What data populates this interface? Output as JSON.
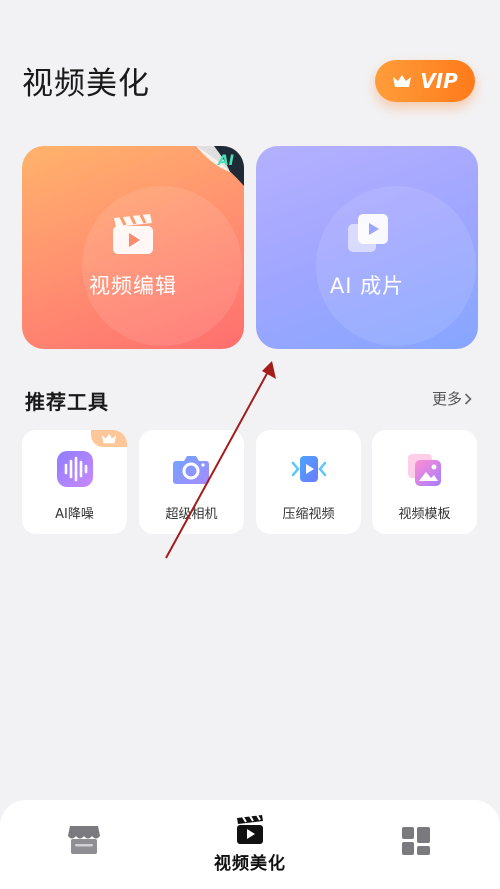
{
  "header": {
    "title": "视频美化",
    "vip_label": "VIP"
  },
  "feature_cards": [
    {
      "label": "视频编辑",
      "icon": "clapperboard-icon",
      "badge": "AI"
    },
    {
      "label": "AI 成片",
      "icon": "stacked-videos-icon"
    }
  ],
  "recommended": {
    "title": "推荐工具",
    "more_label": "更多"
  },
  "tools": [
    {
      "label": "AI降噪",
      "icon": "soundwave-icon",
      "badge": "crown-icon"
    },
    {
      "label": "超级相机",
      "icon": "camera-icon"
    },
    {
      "label": "压缩视频",
      "icon": "compress-video-icon"
    },
    {
      "label": "视频模板",
      "icon": "template-icon"
    }
  ],
  "bottom_nav": {
    "items": [
      {
        "icon": "store-icon"
      },
      {
        "icon": "video-clapper-icon",
        "label": "视频美化",
        "active": true
      },
      {
        "icon": "grid-apps-icon"
      }
    ]
  },
  "colors": {
    "vip_orange": "#ff8a2a",
    "edit_card": "#ff8e6e",
    "ai_card": "#a0a6ff",
    "annotation_arrow": "#a51c1c"
  }
}
